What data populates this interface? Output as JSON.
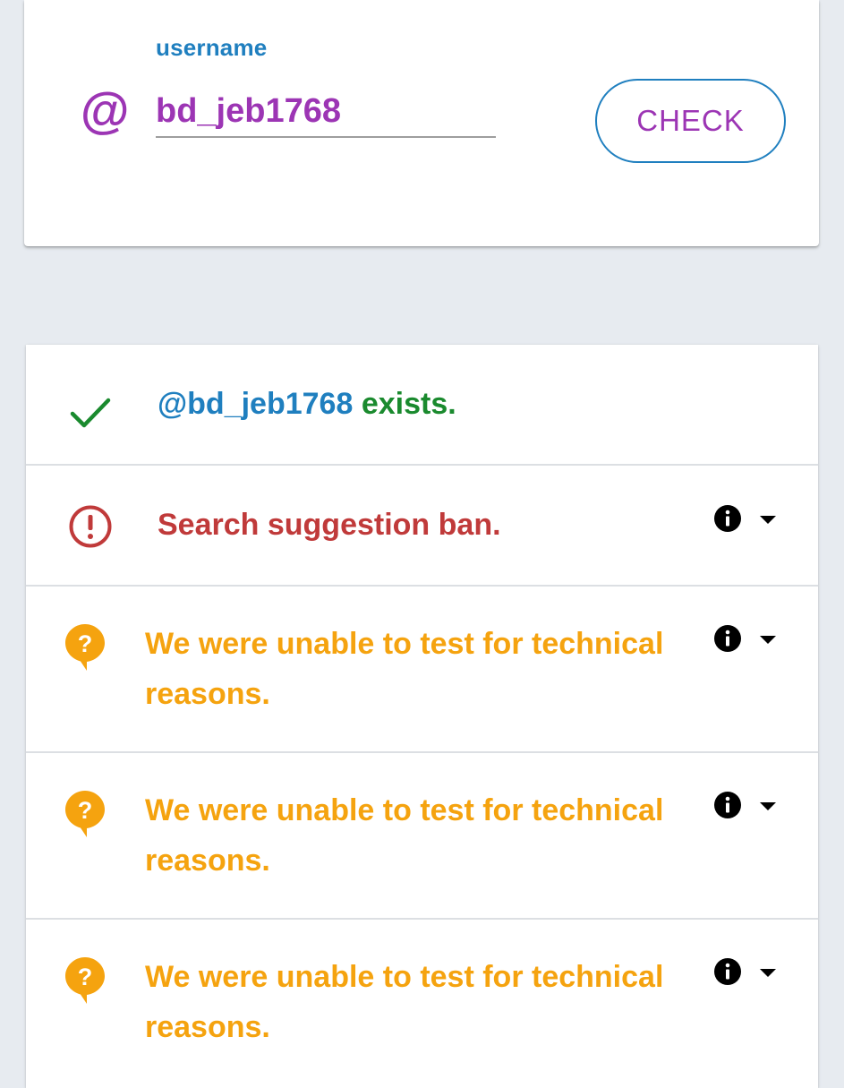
{
  "form": {
    "label": "username",
    "at_symbol": "@",
    "username_value": "bd_jeb1768",
    "check_button_label": "CHECK"
  },
  "results": [
    {
      "status": "success",
      "icon": "check-icon",
      "handle": "@bd_jeb1768",
      "message": "exists.",
      "color": "#1a8a2e"
    },
    {
      "status": "ban",
      "icon": "alert-circle-icon",
      "message": "Search suggestion ban.",
      "color": "#c03a3a",
      "has_info": true
    },
    {
      "status": "unknown",
      "icon": "question-bubble-icon",
      "message": "We were unable to test for technical reasons.",
      "color": "#f5a30f",
      "has_info": true
    },
    {
      "status": "unknown",
      "icon": "question-bubble-icon",
      "message": "We were unable to test for technical reasons.",
      "color": "#f5a30f",
      "has_info": true
    },
    {
      "status": "unknown",
      "icon": "question-bubble-icon",
      "message": "We were unable to test for technical reasons.",
      "color": "#f5a30f",
      "has_info": true
    }
  ],
  "colors": {
    "accent_blue": "#1f7fbf",
    "accent_purple": "#9c35b4",
    "success_green": "#1a8a2e",
    "error_red": "#c03a3a",
    "warning_orange": "#f5a30f",
    "background": "#e7ebf0"
  }
}
